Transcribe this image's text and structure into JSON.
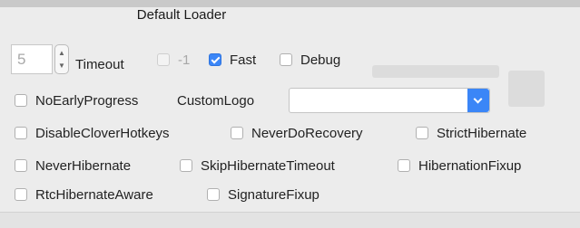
{
  "section_title": "Default Loader",
  "timeout": {
    "value": "5",
    "label": "Timeout"
  },
  "row1": [
    {
      "label": "-1",
      "checked": false,
      "disabled": true
    },
    {
      "label": "Fast",
      "checked": true,
      "disabled": false
    },
    {
      "label": "Debug",
      "checked": false,
      "disabled": false
    }
  ],
  "no_early_progress": {
    "label": "NoEarlyProgress",
    "checked": false
  },
  "custom_logo": {
    "label": "CustomLogo",
    "value": ""
  },
  "row3": [
    {
      "label": "DisableCloverHotkeys",
      "checked": false
    },
    {
      "label": "NeverDoRecovery",
      "checked": false
    },
    {
      "label": "StrictHibernate",
      "checked": false
    }
  ],
  "row4": [
    {
      "label": "NeverHibernate",
      "checked": false
    },
    {
      "label": "SkipHibernateTimeout",
      "checked": false
    },
    {
      "label": "HibernationFixup",
      "checked": false
    }
  ],
  "row5": [
    {
      "label": "RtcHibernateAware",
      "checked": false
    },
    {
      "label": "SignatureFixup",
      "checked": false
    }
  ]
}
